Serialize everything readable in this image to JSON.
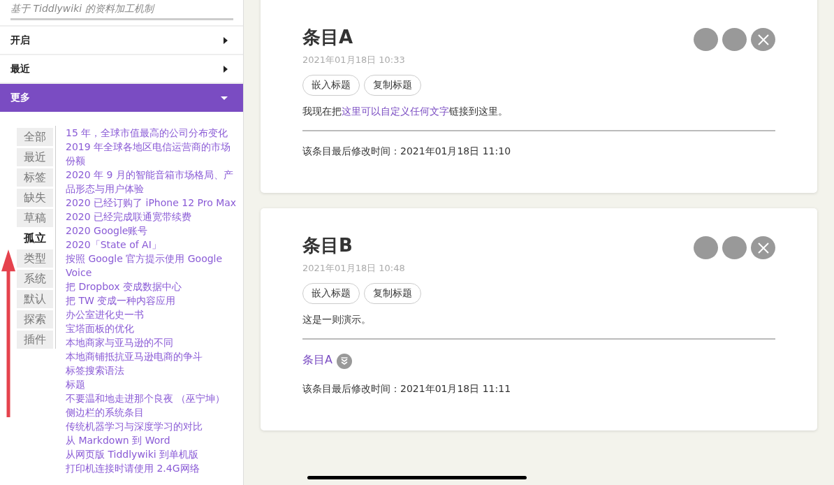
{
  "sidebar": {
    "subtitle": "基于 Tiddlywiki 的资料加工机制",
    "sections": [
      {
        "label": "开启",
        "expanded": false
      },
      {
        "label": "最近",
        "expanded": false
      },
      {
        "label": "更多",
        "expanded": true
      }
    ],
    "tabs": [
      {
        "label": "全部",
        "selected": false
      },
      {
        "label": "最近",
        "selected": false
      },
      {
        "label": "标签",
        "selected": false
      },
      {
        "label": "缺失",
        "selected": false
      },
      {
        "label": "草稿",
        "selected": false
      },
      {
        "label": "孤立",
        "selected": true
      },
      {
        "label": "类型",
        "selected": false
      },
      {
        "label": "系统",
        "selected": false
      },
      {
        "label": "默认",
        "selected": false
      },
      {
        "label": "探索",
        "selected": false
      },
      {
        "label": "插件",
        "selected": false
      }
    ],
    "list": [
      "15 年，全球市值最高的公司分布变化",
      "2019 年全球各地区电信运营商的市场份额",
      "2020 年 9 月的智能音箱市场格局、产品形态与用户体验",
      "2020 已经订购了 iPhone 12 Pro Max",
      "2020 已经完成联通宽带续费",
      "2020 Google账号",
      "2020「State of AI」",
      "按照 Google 官方提示使用 Google Voice",
      "把 Dropbox 变成数据中心",
      "把 TW 变成一种内容应用",
      "办公室进化史一书",
      "宝塔面板的优化",
      "本地商家与亚马逊的不同",
      "本地商铺抵抗亚马逊电商的争斗",
      "标签搜索语法",
      "标题",
      "不要温和地走进那个良夜 （巫宁坤）",
      "侧边栏的系统条目",
      "传统机器学习与深度学习的对比",
      "从 Markdown 到 Word",
      "从网页版 Tiddlywiki 到单机版",
      "打印机连接时请使用 2.4G网络"
    ]
  },
  "tiddlers": [
    {
      "title": "条目A",
      "date": "2021年01月18日 10:33",
      "buttons": [
        "嵌入标题",
        "复制标题"
      ],
      "body": [
        {
          "text": "我现在把",
          "link": false
        },
        {
          "text": "这里可以自定义任何文字",
          "link": true
        },
        {
          "text": "链接到这里。",
          "link": false
        }
      ],
      "modified": "该条目最后修改时间：2021年01月18日 11:10"
    },
    {
      "title": "条目B",
      "date": "2021年01月18日 10:48",
      "buttons": [
        "嵌入标题",
        "复制标题"
      ],
      "body": [
        {
          "text": "这是一则演示。",
          "link": false
        }
      ],
      "backlinks": [
        "条目A"
      ],
      "modified": "该条目最后修改时间：2021年01月18日 11:11"
    }
  ]
}
